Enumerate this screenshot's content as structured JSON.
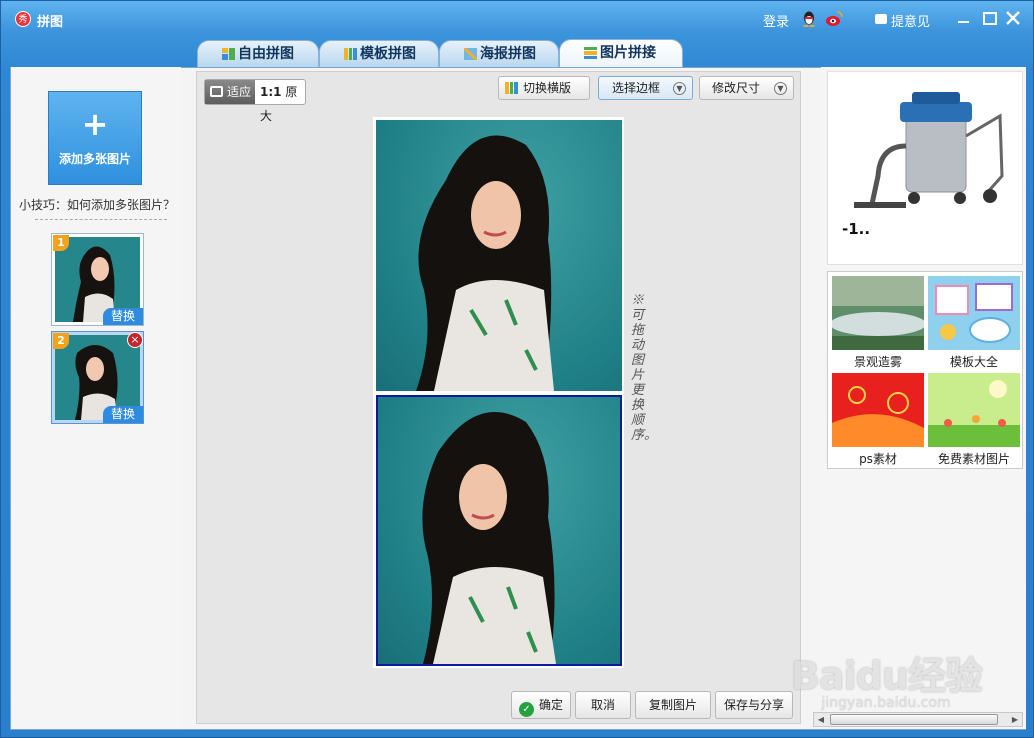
{
  "window": {
    "title": "拼图",
    "app_icon_text": "秀",
    "login_label": "登录",
    "feedback_label": "提意见"
  },
  "tabs": [
    {
      "label": "自由拼图",
      "active": false
    },
    {
      "label": "模板拼图",
      "active": false
    },
    {
      "label": "海报拼图",
      "active": false
    },
    {
      "label": "图片拼接",
      "active": true
    }
  ],
  "left": {
    "add_plus": "+",
    "add_label": "添加多张图片",
    "tip": "小技巧：如何添加多张图片？",
    "thumbs": [
      {
        "number": "1",
        "replace_label": "替换"
      },
      {
        "number": "2",
        "replace_label": "替换",
        "delete_glyph": "×"
      }
    ]
  },
  "toolbar": {
    "fit_label": "适应",
    "original_prefix": "1:1",
    "original_label": "原大",
    "toggle_layout_label": "切换横版",
    "border_label": "选择边框",
    "resize_label": "修改尺寸"
  },
  "hint": "※可拖动图片更换顺序。",
  "actions": {
    "ok_label": "确定",
    "cancel_label": "取消",
    "copy_label": "复制图片",
    "save_share_label": "保存与分享"
  },
  "ad": {
    "caption": "-1.."
  },
  "materials": [
    {
      "label": "景观造雾"
    },
    {
      "label": "模板大全"
    },
    {
      "label": "ps素材"
    },
    {
      "label": "免费素材图片"
    }
  ],
  "watermark": {
    "main": "Baidu经验",
    "sub": "jingyan.baidu.com"
  },
  "colors": {
    "title_bar": "#3d95dc",
    "add_button": "#2f90df",
    "badge": "#f3a21a",
    "selected_border": "#0c1a9c",
    "ok_green": "#25a23e"
  }
}
